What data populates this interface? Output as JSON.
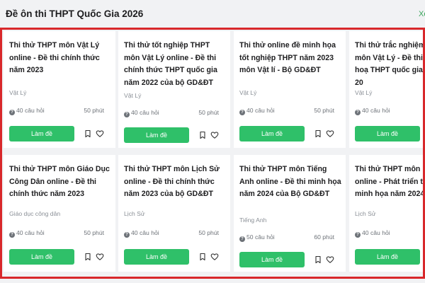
{
  "header": {
    "title": "Đề ôn thi THPT Quốc Gia 2026",
    "link": "Xe"
  },
  "cards": [
    {
      "title": "Thi thử THPT môn Vật Lý online - Đề thi chính thức năm 2023",
      "subject": "Vật Lý",
      "questions": "40 câu hỏi",
      "time": "50 phút",
      "button": "Làm đề"
    },
    {
      "title": "Thi thử tốt nghiệp THPT môn Vật Lý online - Đề thi chính thức THPT quốc gia năm 2022 của bộ GD&ĐT",
      "subject": "Vật Lý",
      "questions": "40 câu hỏi",
      "time": "50 phút",
      "button": "Làm đề"
    },
    {
      "title": "Thi thử online đề minh họa tốt nghiệp THPT năm 2023 môn Vật lí - Bộ GD&ĐT",
      "subject": "Vật Lý",
      "questions": "40 câu hỏi",
      "time": "50 phút",
      "button": "Làm đề"
    },
    {
      "title": "Thi thử trắc nghiệm o môn Vật Lý - Đề thi m hoạ THPT quốc gia 20",
      "subject": "Vật Lý",
      "questions": "40 câu hỏi",
      "time": "",
      "button": "Làm đề"
    },
    {
      "title": "Thi thử THPT môn Giáo Dục Công Dân online - Đề thi chính thức năm 2023",
      "subject": "Giáo dục công dân",
      "questions": "40 câu hỏi",
      "time": "50 phút",
      "button": "Làm đề"
    },
    {
      "title": "Thi thử THPT môn Lịch Sử online - Đề thi chính thức năm 2023 của bộ GD&ĐT",
      "subject": "Lịch Sử",
      "questions": "40 câu hỏi",
      "time": "50 phút",
      "button": "Làm đề"
    },
    {
      "title": "Thi thử THPT môn Tiếng Anh online - Đề thi minh họa năm 2024 của Bộ GD&ĐT",
      "subject": "Tiếng Anh",
      "questions": "50 câu hỏi",
      "time": "60 phút",
      "button": "Làm đề"
    },
    {
      "title": "Thi thử THPT môn Lị online - Phát triển từ minh họa năm 2024 c",
      "subject": "Lịch Sử",
      "questions": "40 câu hỏi",
      "time": "",
      "button": "Làm đề"
    }
  ],
  "colors": {
    "accent": "#2fc069",
    "frame_border": "#d8282b",
    "background": "#f1f2f4"
  },
  "icons": {
    "question": "question-circle-icon",
    "bookmark": "bookmark-icon",
    "heart": "heart-icon"
  }
}
